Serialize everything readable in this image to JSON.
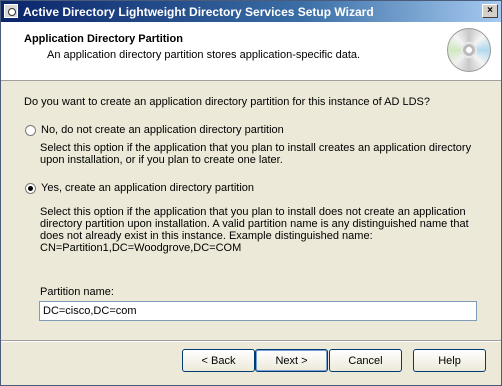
{
  "window": {
    "title": "Active Directory Lightweight Directory Services Setup Wizard",
    "close_label": "×"
  },
  "header": {
    "title": "Application Directory Partition",
    "subtitle": "An application directory partition stores application-specific data.",
    "icon": "cd-disc-icon"
  },
  "question": "Do you want to create an application directory partition for this instance of AD LDS?",
  "options": [
    {
      "label": "No, do not create an application directory partition",
      "checked": false,
      "description": "Select this option if the application that you plan to install creates an application directory upon installation, or if you plan to create one later."
    },
    {
      "label": "Yes, create an application directory partition",
      "checked": true,
      "description": "Select this option if the application that you plan to install does not create an application directory partition upon installation. A valid partition name is any distinguished name that does not already exist in this instance. Example distinguished name: CN=Partition1,DC=Woodgrove,DC=COM"
    }
  ],
  "partition": {
    "label": "Partition name:",
    "value": "DC=cisco,DC=com"
  },
  "buttons": {
    "back": "< Back",
    "next": "Next >",
    "cancel": "Cancel",
    "help": "Help"
  }
}
